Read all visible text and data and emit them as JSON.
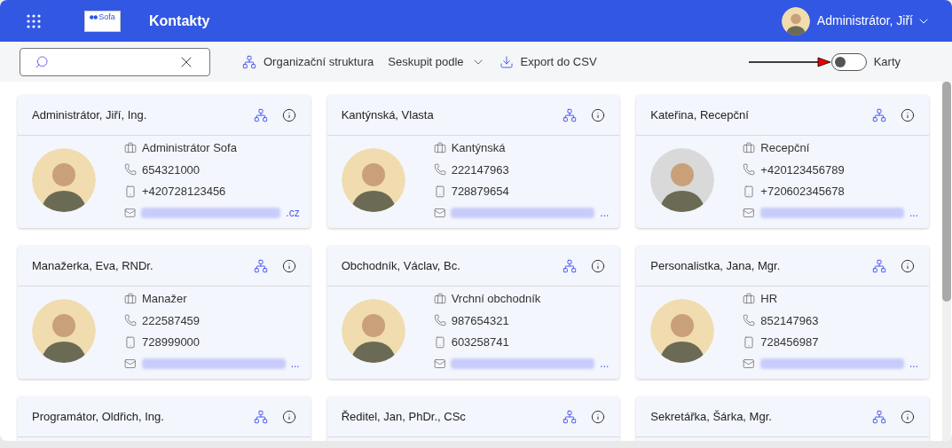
{
  "header": {
    "logo_text": "Sofa",
    "title": "Kontakty",
    "user": "Administrátor, Jiří"
  },
  "toolbar": {
    "actions": [
      {
        "kind": "org",
        "label": "Organizační struktura"
      },
      {
        "kind": "dropdown",
        "label": "Seskupit podle"
      },
      {
        "kind": "export",
        "label": "Export do CSV"
      }
    ],
    "view_toggle": {
      "label": "Karty",
      "on": false
    }
  },
  "cards": [
    {
      "name": "Administrátor, Jiří, Ing.",
      "position": "Administrátor Sofa",
      "phone": "654321000",
      "mobile": "+420728123456",
      "email_tail": ".cz"
    },
    {
      "name": "Kantýnská, Vlasta",
      "position": "Kantýnská",
      "phone": "222147963",
      "mobile": "728879654",
      "email_tail": "..."
    },
    {
      "name": "Kateřina, Recepční",
      "position": "Recepční",
      "phone": "+420123456789",
      "mobile": "+720602345678",
      "email_tail": "..."
    },
    {
      "name": "Manažerka, Eva, RNDr.",
      "position": "Manažer",
      "phone": "222587459",
      "mobile": "728999000",
      "email_tail": "..."
    },
    {
      "name": "Obchodník, Václav, Bc.",
      "position": "Vrchní obchodník",
      "phone": "987654321",
      "mobile": "603258741",
      "email_tail": "..."
    },
    {
      "name": "Personalistka, Jana, Mgr.",
      "position": "HR",
      "phone": "852147963",
      "mobile": "728456987",
      "email_tail": "..."
    },
    {
      "name": "Programátor, Oldřich, Ing."
    },
    {
      "name": "Ředitel, Jan, PhDr., CSc"
    },
    {
      "name": "Sekretářka, Šárka, Mgr."
    }
  ]
}
